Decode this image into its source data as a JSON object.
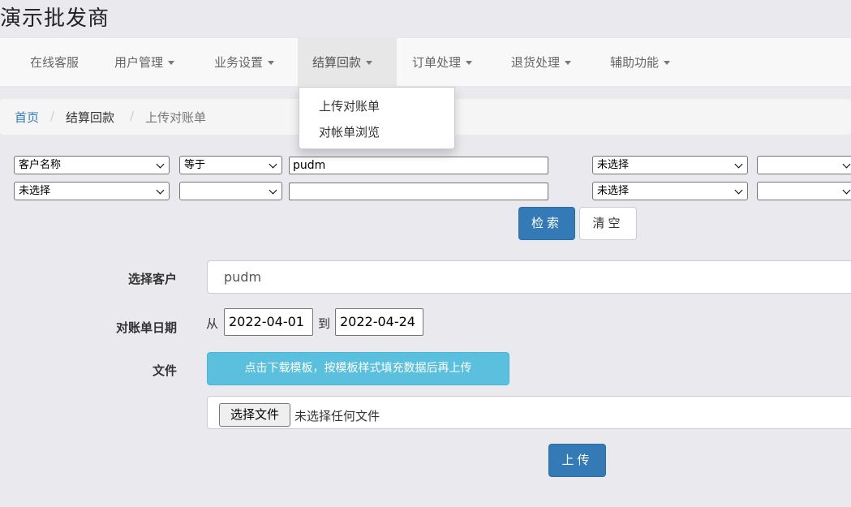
{
  "app": {
    "title": "演示批发商"
  },
  "nav": {
    "items": [
      {
        "label": "在线客服",
        "has_caret": false
      },
      {
        "label": "用户管理",
        "has_caret": true
      },
      {
        "label": "业务设置",
        "has_caret": true
      },
      {
        "label": "结算回款",
        "has_caret": true,
        "active": true
      },
      {
        "label": "订单处理",
        "has_caret": true
      },
      {
        "label": "退货处理",
        "has_caret": true
      },
      {
        "label": "辅助功能",
        "has_caret": true
      }
    ],
    "dropdown": [
      "上传对账单",
      "对帐单浏览"
    ]
  },
  "breadcrumb": {
    "home": "首页",
    "section": "结算回款",
    "current": "上传对账单",
    "separator": "/"
  },
  "search": {
    "row1": {
      "field": "客户名称",
      "operator": "等于",
      "value": "pudm",
      "select_a": "未选择",
      "select_b": ""
    },
    "row2": {
      "field": "未选择",
      "operator": "",
      "value": "",
      "select_a": "未选择",
      "select_b": ""
    },
    "search_button": "检索",
    "clear_button": "清空"
  },
  "form": {
    "customer_label": "选择客户",
    "customer_value": "pudm",
    "date_label": "对账单日期",
    "from_label": "从",
    "from_date": "2022-04-01",
    "to_label": "到",
    "to_date": "2022-04-24",
    "file_label": "文件",
    "template_button": "点击下载模板，按模板样式填充数据后再上传",
    "choose_file_button": "选择文件",
    "no_file_text": "未选择任何文件",
    "upload_button": "上传"
  },
  "colors": {
    "primary": "#337ab7",
    "info": "#5bc0de",
    "link": "#337ab7"
  }
}
